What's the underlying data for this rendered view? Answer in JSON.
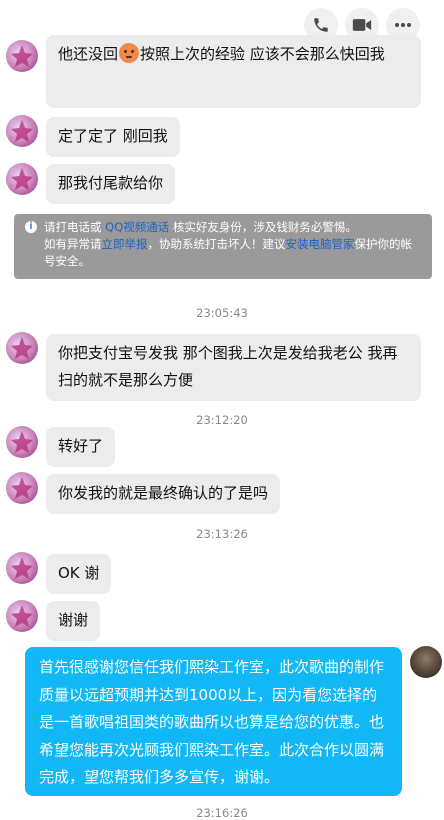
{
  "toolbar": {
    "icons": [
      "phone-icon",
      "video-icon",
      "more-icon"
    ]
  },
  "messages": [
    {
      "side": "left",
      "text_before_emoji": "他还没回",
      "emoji": "blushing-face-emoji",
      "text_after_emoji": "按照上次的经验 应该不会那么快回我"
    },
    {
      "side": "left",
      "text": "定了定了 刚回我"
    },
    {
      "side": "left",
      "text": "那我付尾款给你"
    },
    {
      "side": "left",
      "text": "你把支付宝号发我 那个图我上次是发给我老公 我再扫的就不是那么方便"
    },
    {
      "side": "left",
      "text": "转好了"
    },
    {
      "side": "left",
      "text": "你发我的就是最终确认的了是吗"
    },
    {
      "side": "left",
      "text": "OK 谢"
    },
    {
      "side": "left",
      "text": "谢谢"
    },
    {
      "side": "right",
      "text": "首先很感谢您信任我们熙染工作室，此次歌曲的制作质量以远超预期并达到1000以上，因为看您选择的是一首歌唱祖国类的歌曲所以也算是给您的优惠。也希望您能再次光顾我们熙染工作室。此次合作以圆满完成，望您帮我们多多宣传，谢谢。"
    }
  ],
  "notice": {
    "part1": "请打电话或",
    "link1": "QQ视频通话",
    "part2": "核实好友身份，涉及钱财务必警惕。",
    "part3": "如有异常请",
    "link2": "立即举报",
    "part4": "，协助系统打击坏人！建议",
    "link3": "安装电脑管家",
    "part5": "保护你的帐号安全。"
  },
  "timestamps": [
    "23:05:43",
    "23:12:20",
    "23:13:26",
    "23:16:26"
  ],
  "colors": {
    "left_bubble": "#ececec",
    "right_bubble": "#12b7f5",
    "notice_bg": "#9a9a9a",
    "link": "#1e63c4"
  }
}
